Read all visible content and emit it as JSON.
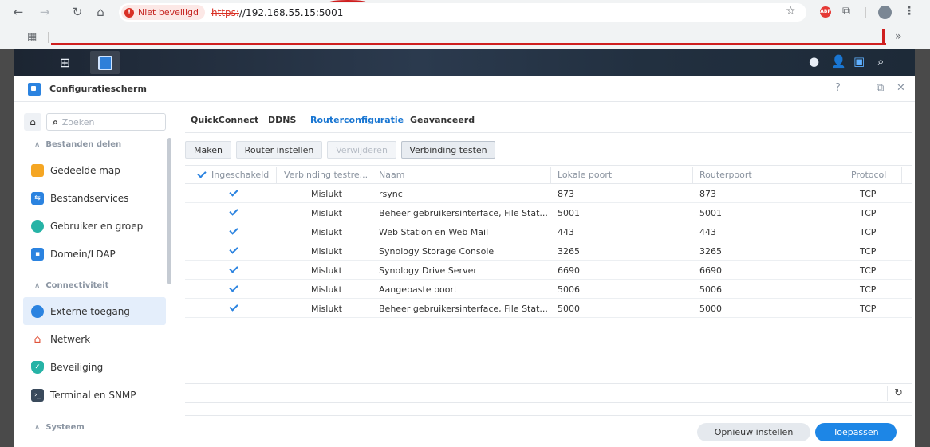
{
  "browser": {
    "not_secure_label": "Niet beveiligd",
    "url_scheme": "https:",
    "url_rest": "//192.168.55.15:5001",
    "more_label": "»"
  },
  "window": {
    "title": "Configuratiescherm",
    "help": "?",
    "minimize": "—",
    "restore": "⧉",
    "close": "✕"
  },
  "sidebar": {
    "search_placeholder": "Zoeken",
    "sections": [
      {
        "label": "Bestanden delen",
        "items": [
          {
            "label": "Gedeelde map",
            "icon": "folder-icon"
          },
          {
            "label": "Bestandservices",
            "icon": "file-services-icon"
          },
          {
            "label": "Gebruiker en groep",
            "icon": "users-icon"
          },
          {
            "label": "Domein/LDAP",
            "icon": "domain-icon"
          }
        ]
      },
      {
        "label": "Connectiviteit",
        "items": [
          {
            "label": "Externe toegang",
            "icon": "external-access-icon",
            "active": true
          },
          {
            "label": "Netwerk",
            "icon": "network-icon"
          },
          {
            "label": "Beveiliging",
            "icon": "shield-icon"
          },
          {
            "label": "Terminal en SNMP",
            "icon": "terminal-icon"
          }
        ]
      },
      {
        "label": "Systeem",
        "items": []
      }
    ]
  },
  "tabs": [
    {
      "label": "QuickConnect"
    },
    {
      "label": "DDNS"
    },
    {
      "label": "Routerconfiguratie",
      "active": true
    },
    {
      "label": "Geavanceerd"
    }
  ],
  "toolbar": {
    "create": "Maken",
    "setup_router": "Router instellen",
    "delete": "Verwijderen",
    "test_connection": "Verbinding testen"
  },
  "table": {
    "columns": [
      "Ingeschakeld",
      "Verbinding testre...",
      "Naam",
      "Lokale poort",
      "Routerpoort",
      "Protocol"
    ],
    "rows": [
      {
        "enabled": true,
        "test": "Mislukt",
        "name": "rsync",
        "local": "873",
        "router": "873",
        "protocol": "TCP"
      },
      {
        "enabled": true,
        "test": "Mislukt",
        "name": "Beheer gebruikersinterface, File Stat...",
        "local": "5001",
        "router": "5001",
        "protocol": "TCP"
      },
      {
        "enabled": true,
        "test": "Mislukt",
        "name": "Web Station en Web Mail",
        "local": "443",
        "router": "443",
        "protocol": "TCP"
      },
      {
        "enabled": true,
        "test": "Mislukt",
        "name": "Synology Storage Console",
        "local": "3265",
        "router": "3265",
        "protocol": "TCP"
      },
      {
        "enabled": true,
        "test": "Mislukt",
        "name": "Synology Drive Server",
        "local": "6690",
        "router": "6690",
        "protocol": "TCP"
      },
      {
        "enabled": true,
        "test": "Mislukt",
        "name": "Aangepaste poort",
        "local": "5006",
        "router": "5006",
        "protocol": "TCP"
      },
      {
        "enabled": true,
        "test": "Mislukt",
        "name": "Beheer gebruikersinterface, File Stat...",
        "local": "5000",
        "router": "5000",
        "protocol": "TCP"
      }
    ]
  },
  "footer": {
    "reset": "Opnieuw instellen",
    "apply": "Toepassen"
  },
  "colors": {
    "accent": "#1d86e6",
    "active_tab": "#1976d2",
    "sidebar_active_bg": "#e4eefb"
  }
}
